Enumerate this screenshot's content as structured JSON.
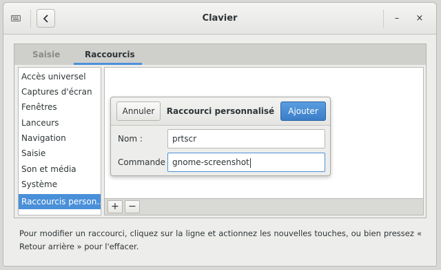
{
  "window": {
    "title": "Clavier",
    "minimize_label": "–",
    "close_label": "×"
  },
  "tabs": [
    {
      "label": "Saisie",
      "active": false
    },
    {
      "label": "Raccourcis",
      "active": true
    }
  ],
  "sidebar": {
    "items": [
      {
        "label": "Accès universel"
      },
      {
        "label": "Captures d'écran"
      },
      {
        "label": "Fenêtres"
      },
      {
        "label": "Lanceurs"
      },
      {
        "label": "Navigation"
      },
      {
        "label": "Saisie"
      },
      {
        "label": "Son et média"
      },
      {
        "label": "Système"
      },
      {
        "label": "Raccourcis person...",
        "selected": true
      }
    ]
  },
  "toolbar": {
    "add_label": "+",
    "remove_label": "−"
  },
  "help_text": "Pour modifier un raccourci, cliquez sur la ligne et actionnez les nouvelles touches, ou bien pressez « Retour arrière » pour l'effacer.",
  "dialog": {
    "title": "Raccourci personnalisé",
    "cancel_label": "Annuler",
    "add_label": "Ajouter",
    "name_label": "Nom :",
    "name_value": "prtscr",
    "command_label": "Commande :",
    "command_value": "gnome-screenshot"
  },
  "colors": {
    "accent": "#4a90d9",
    "selected_text": "#ffffff"
  }
}
